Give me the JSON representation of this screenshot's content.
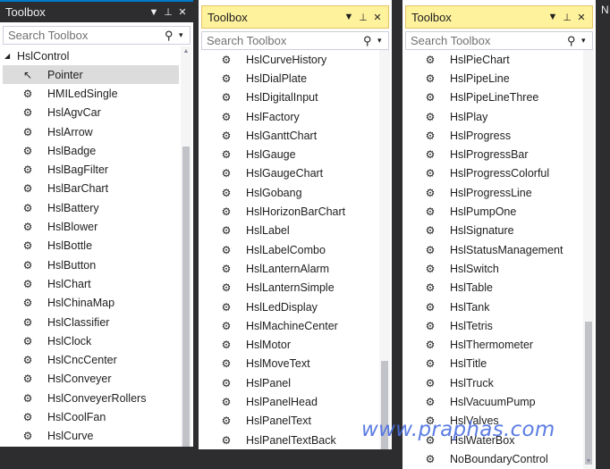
{
  "panel1": {
    "title": "Toolbox",
    "search_placeholder": "Search Toolbox",
    "category": "HslControl",
    "items": [
      "Pointer",
      "HMILedSingle",
      "HslAgvCar",
      "HslArrow",
      "HslBadge",
      "HslBagFilter",
      "HslBarChart",
      "HslBattery",
      "HslBlower",
      "HslBottle",
      "HslButton",
      "HslChart",
      "HslChinaMap",
      "HslClassifier",
      "HslClock",
      "HslCncCenter",
      "HslConveyer",
      "HslConveyerRollers",
      "HslCoolFan",
      "HslCurve"
    ]
  },
  "panel2": {
    "title": "Toolbox",
    "search_placeholder": "Search Toolbox",
    "items": [
      "HslCurveHistory",
      "HslDialPlate",
      "HslDigitalInput",
      "HslFactory",
      "HslGanttChart",
      "HslGauge",
      "HslGaugeChart",
      "HslGobang",
      "HslHorizonBarChart",
      "HslLabel",
      "HslLabelCombo",
      "HslLanternAlarm",
      "HslLanternSimple",
      "HslLedDisplay",
      "HslMachineCenter",
      "HslMotor",
      "HslMoveText",
      "HslPanel",
      "HslPanelHead",
      "HslPanelText",
      "HslPanelTextBack"
    ]
  },
  "panel3": {
    "title": "Toolbox",
    "search_placeholder": "Search Toolbox",
    "items": [
      "HslPieChart",
      "HslPipeLine",
      "HslPipeLineThree",
      "HslPlay",
      "HslProgress",
      "HslProgressBar",
      "HslProgressColorful",
      "HslProgressLine",
      "HslPumpOne",
      "HslSignature",
      "HslStatusManagement",
      "HslSwitch",
      "HslTable",
      "HslTank",
      "HslTetris",
      "HslThermometer",
      "HslTitle",
      "HslTruck",
      "HslVacuumPump",
      "HslValves",
      "HslWaterBox",
      "NoBoundaryControl"
    ]
  },
  "panel4": {
    "title": "N"
  },
  "watermark": "www.praphas.com",
  "icons": {
    "dropdown": "chevron-down-icon",
    "pin": "pin-icon",
    "close": "close-icon",
    "search": "search-icon",
    "control": "component-icon",
    "pointer": "pointer-icon"
  },
  "colors": {
    "dark_bg": "#2d2d30",
    "active_title": "#fff29d",
    "accent": "#007acc",
    "watermark": "#4a6ee0"
  }
}
